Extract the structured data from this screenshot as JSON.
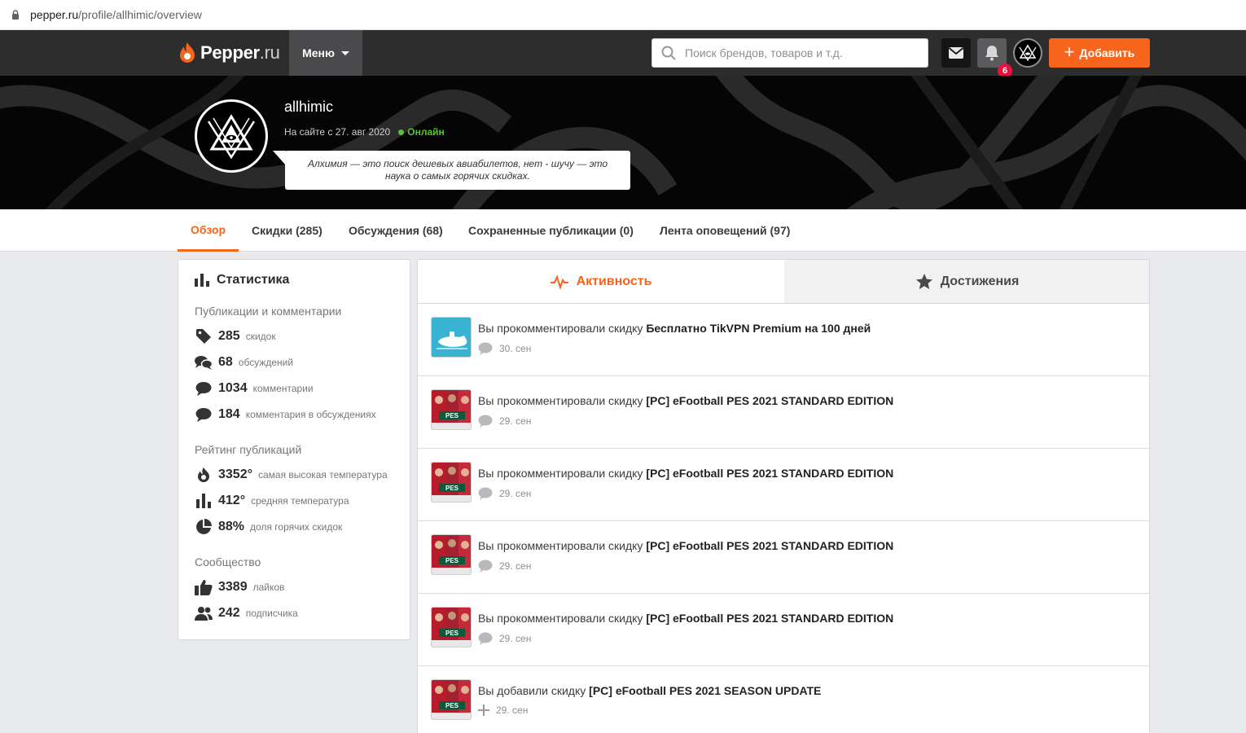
{
  "browser": {
    "url_domain": "pepper.ru",
    "url_path": "/profile/allhimic/overview"
  },
  "nav": {
    "logo_main": "Pepper",
    "logo_tld": ".ru",
    "menu_label": "Меню",
    "search_placeholder": "Поиск брендов, товаров и т.д.",
    "notification_count": "6",
    "add_label": "Добавить",
    "accent_color": "#f7641b"
  },
  "profile": {
    "username": "allhimic",
    "joined": "На сайте с 27. авг 2020",
    "status": "Онлайн",
    "bio": "Алхимия — это поиск дешевых авиабилетов, нет - шучу — это наука о самых горячих скидках."
  },
  "tabs": [
    {
      "label": "Обзор",
      "active": true
    },
    {
      "label": "Скидки (285)",
      "active": false
    },
    {
      "label": "Обсуждения (68)",
      "active": false
    },
    {
      "label": "Сохраненные публикации (0)",
      "active": false
    },
    {
      "label": "Лента оповещений (97)",
      "active": false
    }
  ],
  "stats": {
    "title": "Статистика",
    "sections": [
      {
        "label": "Публикации и комментарии"
      },
      {
        "label": "Рейтинг публикаций"
      },
      {
        "label": "Сообщество"
      }
    ],
    "rows": [
      {
        "icon": "tag-icon",
        "value": "285",
        "label": "скидок"
      },
      {
        "icon": "discussions-icon",
        "value": "68",
        "label": "обсуждений"
      },
      {
        "icon": "comment-icon",
        "value": "1034",
        "label": "комментарии"
      },
      {
        "icon": "comment-icon",
        "value": "184",
        "label": "комментария в обсуждениях"
      },
      {
        "icon": "flame-icon",
        "value": "3352°",
        "label": "самая высокая температура"
      },
      {
        "icon": "bar-chart-icon",
        "value": "412°",
        "label": "средняя температура"
      },
      {
        "icon": "pie-chart-icon",
        "value": "88%",
        "label": "доля горячих скидок"
      },
      {
        "icon": "thumbs-up-icon",
        "value": "3389",
        "label": "лайков"
      },
      {
        "icon": "users-icon",
        "value": "242",
        "label": "подписчика"
      }
    ]
  },
  "activity": {
    "tab_activity": "Активность",
    "tab_achievements": "Достижения",
    "items": [
      {
        "prefix": "Вы прокомментировали скидку",
        "title": "Бесплатно TikVPN Premium на 100 дней",
        "date": "30. сен",
        "kind": "comment",
        "thumb": "vpn"
      },
      {
        "prefix": "Вы прокомментировали скидку",
        "title": "[PC] eFootball PES 2021 STANDARD EDITION",
        "date": "29. сен",
        "kind": "comment",
        "thumb": "pes"
      },
      {
        "prefix": "Вы прокомментировали скидку",
        "title": "[PC] eFootball PES 2021 STANDARD EDITION",
        "date": "29. сен",
        "kind": "comment",
        "thumb": "pes"
      },
      {
        "prefix": "Вы прокомментировали скидку",
        "title": "[PC] eFootball PES 2021 STANDARD EDITION",
        "date": "29. сен",
        "kind": "comment",
        "thumb": "pes"
      },
      {
        "prefix": "Вы прокомментировали скидку",
        "title": "[PC] eFootball PES 2021 STANDARD EDITION",
        "date": "29. сен",
        "kind": "comment",
        "thumb": "pes"
      },
      {
        "prefix": "Вы добавили скидку",
        "title": "[PC] eFootball PES 2021 SEASON UPDATE",
        "date": "29. сен",
        "kind": "add",
        "thumb": "pes"
      }
    ]
  }
}
